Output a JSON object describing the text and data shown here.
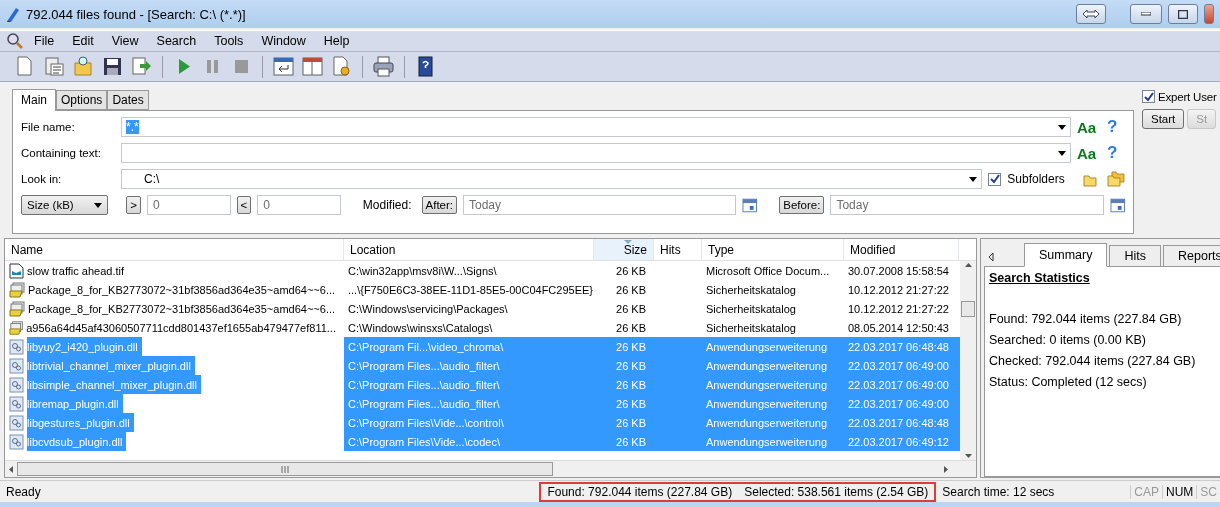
{
  "window": {
    "title": "792.044 files found - [Search: C:\\ (*.*)]"
  },
  "menu": [
    "File",
    "Edit",
    "View",
    "Search",
    "Tools",
    "Window",
    "Help"
  ],
  "search": {
    "tabs": [
      {
        "label": "Main",
        "selected": true
      },
      {
        "label": "Options",
        "selected": false
      },
      {
        "label": "Dates",
        "selected": false
      }
    ],
    "file_name": {
      "label": "File name:",
      "value": "*.*",
      "match_case": "Aa",
      "help": "?"
    },
    "containing_text": {
      "label": "Containing text:",
      "match_case": "Aa",
      "help": "?"
    },
    "look_in": {
      "label": "Look in:",
      "value": "C:\\"
    },
    "subfolders": {
      "label": "Subfolders",
      "checked": true
    },
    "size": {
      "unit": "Size (kB)",
      "greater": ">",
      "greater_value": "0",
      "less": "<",
      "less_value": "0"
    },
    "modified": {
      "label": "Modified:",
      "after": "After:",
      "after_placeholder": "Today",
      "before": "Before:",
      "before_placeholder": "Today"
    }
  },
  "side": {
    "expert_user": {
      "label": "Expert User",
      "checked": true
    },
    "start": "Start",
    "stop": "St"
  },
  "results": {
    "columns": [
      {
        "label": "Name",
        "sorted": false
      },
      {
        "label": "Location",
        "sorted": false
      },
      {
        "label": "Size",
        "sorted": true
      },
      {
        "label": "Hits",
        "sorted": false
      },
      {
        "label": "Type",
        "sorted": false
      },
      {
        "label": "Modified",
        "sorted": false
      }
    ],
    "rows": [
      {
        "kind": "image",
        "name": "slow traffic ahead.tif",
        "location": "C:\\win32app\\msv8i\\W...\\Signs\\",
        "size": "26 KB",
        "type": "Microsoft Office Docum...",
        "modified": "30.07.2008 15:58:54",
        "selected": false
      },
      {
        "kind": "catalog",
        "name": "Package_8_for_KB2773072~31bf3856ad364e35~amd64~~6...",
        "location": "...\\{F750E6C3-38EE-11D1-85E5-00C04FC295EE}",
        "size": "26 KB",
        "type": "Sicherheitskatalog",
        "modified": "10.12.2012 21:27:22",
        "selected": false
      },
      {
        "kind": "catalog",
        "name": "Package_8_for_KB2773072~31bf3856ad364e35~amd64~~6...",
        "location": "C:\\Windows\\servicing\\Packages\\",
        "size": "26 KB",
        "type": "Sicherheitskatalog",
        "modified": "10.12.2012 21:27:22",
        "selected": false
      },
      {
        "kind": "catalog",
        "name": "a956a64d45af43060507711cdd801437ef1655ab479477ef811...",
        "location": "C:\\Windows\\winsxs\\Catalogs\\",
        "size": "26 KB",
        "type": "Sicherheitskatalog",
        "modified": "08.05.2014 12:50:43",
        "selected": false
      },
      {
        "kind": "dll",
        "name": "libyuy2_i420_plugin.dll",
        "location": "C:\\Program Fil...\\video_chroma\\",
        "size": "26 KB",
        "type": "Anwendungserweiterung",
        "modified": "22.03.2017 06:48:48",
        "selected": true
      },
      {
        "kind": "dll",
        "name": "libtrivial_channel_mixer_plugin.dll",
        "location": "C:\\Program Files...\\audio_filter\\",
        "size": "26 KB",
        "type": "Anwendungserweiterung",
        "modified": "22.03.2017 06:49:00",
        "selected": true
      },
      {
        "kind": "dll",
        "name": "libsimple_channel_mixer_plugin.dll",
        "location": "C:\\Program Files...\\audio_filter\\",
        "size": "26 KB",
        "type": "Anwendungserweiterung",
        "modified": "22.03.2017 06:49:00",
        "selected": true
      },
      {
        "kind": "dll",
        "name": "libremap_plugin.dll",
        "location": "C:\\Program Files...\\audio_filter\\",
        "size": "26 KB",
        "type": "Anwendungserweiterung",
        "modified": "22.03.2017 06:49:00",
        "selected": true
      },
      {
        "kind": "dll",
        "name": "libgestures_plugin.dll",
        "location": "C:\\Program Files\\Vide...\\control\\",
        "size": "26 KB",
        "type": "Anwendungserweiterung",
        "modified": "22.03.2017 06:48:48",
        "selected": true
      },
      {
        "kind": "dll",
        "name": "libcvdsub_plugin.dll",
        "location": "C:\\Program Files\\Vide...\\codec\\",
        "size": "26 KB",
        "type": "Anwendungserweiterung",
        "modified": "22.03.2017 06:49:12",
        "selected": true
      }
    ]
  },
  "summary": {
    "tabs": [
      {
        "label": "Summary",
        "selected": true
      },
      {
        "label": "Hits",
        "selected": false
      },
      {
        "label": "Reports",
        "selected": false
      }
    ],
    "heading": "Search Statistics",
    "lines": [
      "Found: 792.044 items (227.84 GB)",
      "Searched: 0 items (0.00 KB)",
      "Checked: 792.044 items (227.84 GB)",
      "Status: Completed (12 secs)"
    ]
  },
  "status_bar": {
    "message": "Ready",
    "found": "Found: 792.044 items (227.84 GB)",
    "selected": "Selected: 538.561 items (2.54 GB)",
    "search_time": "Search time: 12 secs",
    "indicators": [
      {
        "label": "CAP",
        "on": false
      },
      {
        "label": "NUM",
        "on": true
      },
      {
        "label": "SC",
        "on": false
      }
    ]
  }
}
